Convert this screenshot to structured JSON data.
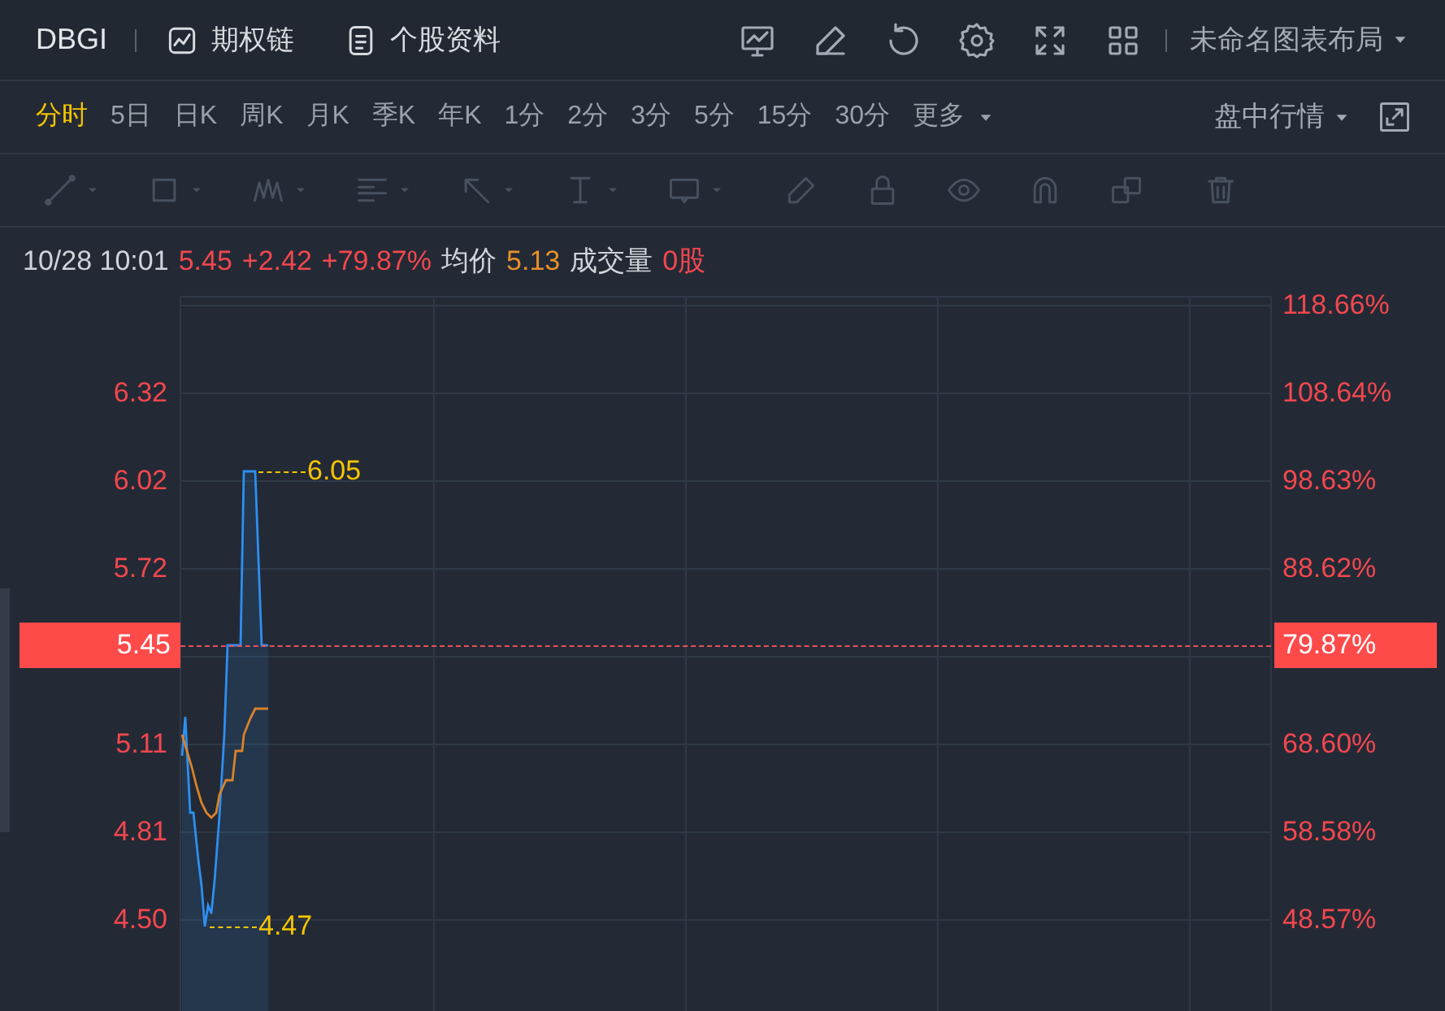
{
  "header": {
    "symbol": "DBGI",
    "links": [
      {
        "label": "期权链",
        "kind": "chart"
      },
      {
        "label": "个股资料",
        "kind": "doc"
      }
    ],
    "layout_menu": "未命名图表布局"
  },
  "periods": [
    {
      "label": "分时",
      "selected": true,
      "kind": "tab"
    },
    {
      "label": "5日",
      "selected": false,
      "kind": "tab"
    },
    {
      "label": "日K",
      "selected": false,
      "kind": "tab"
    },
    {
      "label": "周K",
      "selected": false,
      "kind": "tab"
    },
    {
      "label": "月K",
      "selected": false,
      "kind": "tab"
    },
    {
      "label": "季K",
      "selected": false,
      "kind": "tab"
    },
    {
      "label": "年K",
      "selected": false,
      "kind": "tab"
    },
    {
      "label": "1分",
      "selected": false,
      "kind": "tab"
    },
    {
      "label": "2分",
      "selected": false,
      "kind": "tab"
    },
    {
      "label": "3分",
      "selected": false,
      "kind": "tab"
    },
    {
      "label": "5分",
      "selected": false,
      "kind": "tab"
    },
    {
      "label": "15分",
      "selected": false,
      "kind": "tab"
    },
    {
      "label": "30分",
      "selected": false,
      "kind": "tab"
    },
    {
      "label": "更多",
      "selected": false,
      "kind": "dropdown"
    }
  ],
  "session_menu": "盘中行情",
  "drawing_toolbar": {
    "disabled": true
  },
  "quote": {
    "time": "10/28 10:01",
    "price": "5.45",
    "change": "+2.42",
    "change_pct": "+79.87%",
    "avg_label": "均价",
    "avg": "5.13",
    "volume_label": "成交量",
    "volume": "0股"
  },
  "chart": {
    "price_axis": [
      "6.32",
      "6.02",
      "5.72",
      "5.11",
      "4.81",
      "4.50"
    ],
    "percent_axis": [
      "118.66%",
      "108.64%",
      "98.63%",
      "88.62%",
      "68.60%",
      "58.58%",
      "48.57%"
    ],
    "high_label": "6.05",
    "low_label": "4.47",
    "current_price": "5.45",
    "current_percent": "79.87%"
  }
}
